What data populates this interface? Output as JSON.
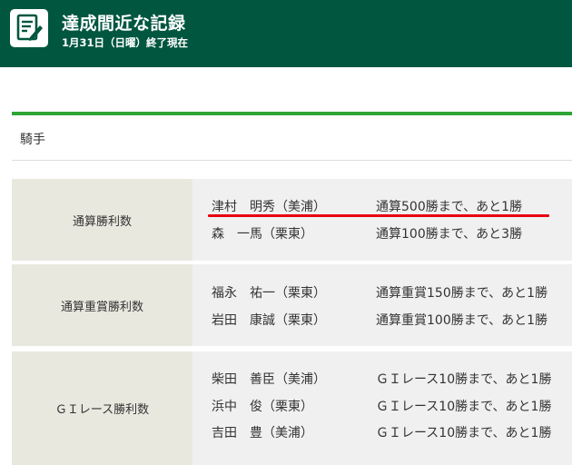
{
  "header": {
    "title": "達成間近な記録",
    "subtitle": "1月31日（日曜）終了現在",
    "icon": "edit-note-icon",
    "bg_color": "#00563f"
  },
  "section": {
    "title": "騎手",
    "rule_color": "#2ea535"
  },
  "records": [
    {
      "category": "通算勝利数",
      "entries": [
        {
          "name": "津村　明秀（美浦）",
          "note": "通算500勝まで、あと1勝",
          "highlighted": true
        },
        {
          "name": "森　一馬（栗東）",
          "note": "通算100勝まで、あと3勝"
        }
      ]
    },
    {
      "category": "通算重賞勝利数",
      "entries": [
        {
          "name": "福永　祐一（栗東）",
          "note": "通算重賞150勝まで、あと1勝"
        },
        {
          "name": "岩田　康誠（栗東）",
          "note": "通算重賞100勝まで、あと1勝"
        }
      ]
    },
    {
      "category": "ＧＩレース勝利数",
      "entries": [
        {
          "name": "柴田　善臣（美浦）",
          "note": "ＧＩレース10勝まで、あと1勝"
        },
        {
          "name": "浜中　俊（栗東）",
          "note": "ＧＩレース10勝まで、あと1勝"
        },
        {
          "name": "吉田　豊（美浦）",
          "note": "ＧＩレース10勝まで、あと1勝"
        }
      ]
    }
  ],
  "highlight_color": "#e60012"
}
